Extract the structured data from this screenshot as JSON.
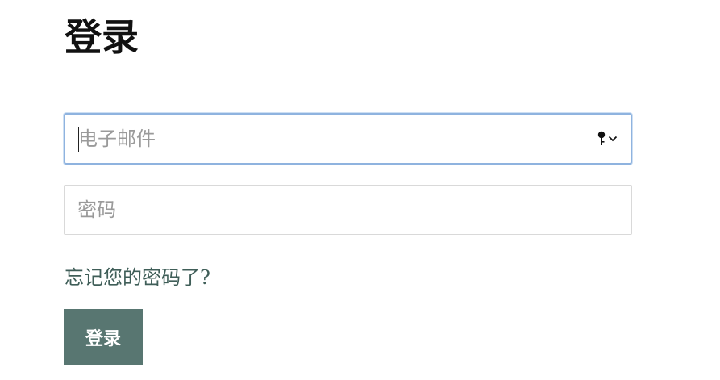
{
  "form": {
    "title": "登录",
    "email": {
      "placeholder": "电子邮件",
      "value": "",
      "autofill_icon": "key-icon",
      "dropdown_icon": "chevron-down-icon"
    },
    "password": {
      "placeholder": "密码",
      "value": ""
    },
    "forgot_link": "忘记您的密码了?",
    "submit_label": "登录"
  },
  "colors": {
    "focus_border": "#8fb3df",
    "button_bg": "#587671",
    "link": "#3f5e58"
  }
}
